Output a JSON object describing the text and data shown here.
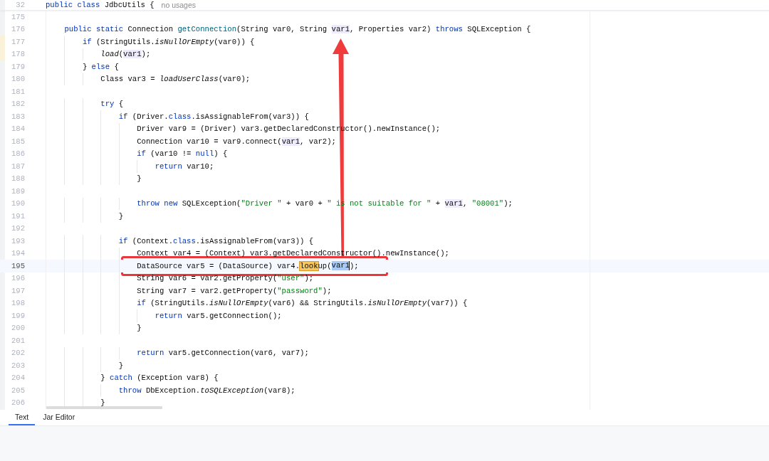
{
  "sticky_header": {
    "line_number": "32",
    "tokens": [
      {
        "text": "public class",
        "kind": "keyword"
      },
      {
        "text": " JdbcUtils {",
        "kind": "plain"
      }
    ],
    "hint": "no usages"
  },
  "code_lines": [
    {
      "number": "175",
      "current": false,
      "changed": false
    },
    {
      "number": "176",
      "current": false,
      "changed": false,
      "tokens": [
        {
          "text": "    public static",
          "kind": "keyword"
        },
        {
          "text": " Connection ",
          "kind": "plain"
        },
        {
          "text": "getConnection",
          "kind": "method"
        },
        {
          "text": "(String var0, String ",
          "kind": "plain"
        },
        {
          "text": "var1",
          "kind": "usage"
        },
        {
          "text": ", Properties var2) ",
          "kind": "plain"
        },
        {
          "text": "throws",
          "kind": "keyword"
        },
        {
          "text": " SQLException {",
          "kind": "plain"
        }
      ]
    },
    {
      "number": "177",
      "current": false,
      "changed": true,
      "tokens": [
        {
          "text": "        if",
          "kind": "keyword"
        },
        {
          "text": " (StringUtils.",
          "kind": "plain"
        },
        {
          "text": "isNullOrEmpty",
          "kind": "static"
        },
        {
          "text": "(var0)) {",
          "kind": "plain"
        }
      ]
    },
    {
      "number": "178",
      "current": false,
      "changed": true,
      "tokens": [
        {
          "text": "            load",
          "kind": "static"
        },
        {
          "text": "(",
          "kind": "plain"
        },
        {
          "text": "var1",
          "kind": "usage"
        },
        {
          "text": ");",
          "kind": "plain"
        }
      ]
    },
    {
      "number": "179",
      "current": false,
      "changed": false,
      "tokens": [
        {
          "text": "        } ",
          "kind": "plain"
        },
        {
          "text": "else",
          "kind": "keyword"
        },
        {
          "text": " {",
          "kind": "plain"
        }
      ]
    },
    {
      "number": "180",
      "current": false,
      "changed": false,
      "tokens": [
        {
          "text": "            Class var3 = ",
          "kind": "plain"
        },
        {
          "text": "loadUserClass",
          "kind": "static"
        },
        {
          "text": "(var0);",
          "kind": "plain"
        }
      ]
    },
    {
      "number": "181",
      "current": false,
      "changed": false
    },
    {
      "number": "182",
      "current": false,
      "changed": false,
      "tokens": [
        {
          "text": "            try",
          "kind": "keyword"
        },
        {
          "text": " {",
          "kind": "plain"
        }
      ]
    },
    {
      "number": "183",
      "current": false,
      "changed": false,
      "tokens": [
        {
          "text": "                if",
          "kind": "keyword"
        },
        {
          "text": " (Driver.",
          "kind": "plain"
        },
        {
          "text": "class",
          "kind": "keyword"
        },
        {
          "text": ".isAssignableFrom(var3)) {",
          "kind": "plain"
        }
      ]
    },
    {
      "number": "184",
      "current": false,
      "changed": false,
      "tokens": [
        {
          "text": "                    Driver var9 = (Driver) var3.getDeclaredConstructor().newInstance();",
          "kind": "plain"
        }
      ]
    },
    {
      "number": "185",
      "current": false,
      "changed": false,
      "tokens": [
        {
          "text": "                    Connection var10 = var9.connect(",
          "kind": "plain"
        },
        {
          "text": "var1",
          "kind": "usage"
        },
        {
          "text": ", var2);",
          "kind": "plain"
        }
      ]
    },
    {
      "number": "186",
      "current": false,
      "changed": false,
      "tokens": [
        {
          "text": "                    if",
          "kind": "keyword"
        },
        {
          "text": " (var10 != ",
          "kind": "plain"
        },
        {
          "text": "null",
          "kind": "keyword"
        },
        {
          "text": ") {",
          "kind": "plain"
        }
      ]
    },
    {
      "number": "187",
      "current": false,
      "changed": false,
      "tokens": [
        {
          "text": "                        return",
          "kind": "keyword"
        },
        {
          "text": " var10;",
          "kind": "plain"
        }
      ]
    },
    {
      "number": "188",
      "current": false,
      "changed": false,
      "tokens": [
        {
          "text": "                    }",
          "kind": "plain"
        }
      ]
    },
    {
      "number": "189",
      "current": false,
      "changed": false
    },
    {
      "number": "190",
      "current": false,
      "changed": false,
      "tokens": [
        {
          "text": "                    throw new",
          "kind": "keyword"
        },
        {
          "text": " SQLException(",
          "kind": "plain"
        },
        {
          "text": "\"Driver \"",
          "kind": "string"
        },
        {
          "text": " + var0 + ",
          "kind": "plain"
        },
        {
          "text": "\" is not suitable for \"",
          "kind": "string"
        },
        {
          "text": " + ",
          "kind": "plain"
        },
        {
          "text": "var1",
          "kind": "usage"
        },
        {
          "text": ", ",
          "kind": "plain"
        },
        {
          "text": "\"08001\"",
          "kind": "string"
        },
        {
          "text": ");",
          "kind": "plain"
        }
      ]
    },
    {
      "number": "191",
      "current": false,
      "changed": false,
      "tokens": [
        {
          "text": "                }",
          "kind": "plain"
        }
      ]
    },
    {
      "number": "192",
      "current": false,
      "changed": false
    },
    {
      "number": "193",
      "current": false,
      "changed": false,
      "tokens": [
        {
          "text": "                if",
          "kind": "keyword"
        },
        {
          "text": " (Context.",
          "kind": "plain"
        },
        {
          "text": "class",
          "kind": "keyword"
        },
        {
          "text": ".isAssignableFrom(var3)) {",
          "kind": "plain"
        }
      ]
    },
    {
      "number": "194",
      "current": false,
      "changed": false,
      "tokens": [
        {
          "text": "                    Context var4 = (Context) var3.getDeclaredConstructor().newInstance();",
          "kind": "plain"
        }
      ]
    },
    {
      "number": "195",
      "current": true,
      "changed": false,
      "tokens": [
        {
          "text": "                    DataSource var5 = (DataSource) var4.",
          "kind": "plain"
        },
        {
          "text": "look",
          "kind": "search-match"
        },
        {
          "text": "up(",
          "kind": "plain"
        },
        {
          "text": "var1",
          "kind": "selection-caret"
        },
        {
          "text": ");",
          "kind": "plain"
        }
      ]
    },
    {
      "number": "196",
      "current": false,
      "changed": false,
      "tokens": [
        {
          "text": "                    String var6 = var2.getProperty(",
          "kind": "plain"
        },
        {
          "text": "\"user\"",
          "kind": "string"
        },
        {
          "text": ");",
          "kind": "plain"
        }
      ]
    },
    {
      "number": "197",
      "current": false,
      "changed": false,
      "tokens": [
        {
          "text": "                    String var7 = var2.getProperty(",
          "kind": "plain"
        },
        {
          "text": "\"password\"",
          "kind": "string"
        },
        {
          "text": ");",
          "kind": "plain"
        }
      ]
    },
    {
      "number": "198",
      "current": false,
      "changed": false,
      "tokens": [
        {
          "text": "                    if",
          "kind": "keyword"
        },
        {
          "text": " (StringUtils.",
          "kind": "plain"
        },
        {
          "text": "isNullOrEmpty",
          "kind": "static"
        },
        {
          "text": "(var6) && StringUtils.",
          "kind": "plain"
        },
        {
          "text": "isNullOrEmpty",
          "kind": "static"
        },
        {
          "text": "(var7)) {",
          "kind": "plain"
        }
      ]
    },
    {
      "number": "199",
      "current": false,
      "changed": false,
      "tokens": [
        {
          "text": "                        return",
          "kind": "keyword"
        },
        {
          "text": " var5.getConnection();",
          "kind": "plain"
        }
      ]
    },
    {
      "number": "200",
      "current": false,
      "changed": false,
      "tokens": [
        {
          "text": "                    }",
          "kind": "plain"
        }
      ]
    },
    {
      "number": "201",
      "current": false,
      "changed": false
    },
    {
      "number": "202",
      "current": false,
      "changed": false,
      "tokens": [
        {
          "text": "                    return",
          "kind": "keyword"
        },
        {
          "text": " var5.getConnection(var6, var7);",
          "kind": "plain"
        }
      ]
    },
    {
      "number": "203",
      "current": false,
      "changed": false,
      "tokens": [
        {
          "text": "                }",
          "kind": "plain"
        }
      ]
    },
    {
      "number": "204",
      "current": false,
      "changed": false,
      "tokens": [
        {
          "text": "            } ",
          "kind": "plain"
        },
        {
          "text": "catch",
          "kind": "keyword"
        },
        {
          "text": " (Exception var8) {",
          "kind": "plain"
        }
      ]
    },
    {
      "number": "205",
      "current": false,
      "changed": false,
      "tokens": [
        {
          "text": "                throw",
          "kind": "keyword"
        },
        {
          "text": " DbException.",
          "kind": "plain"
        },
        {
          "text": "toSQLException",
          "kind": "static"
        },
        {
          "text": "(var8);",
          "kind": "plain"
        }
      ]
    },
    {
      "number": "206",
      "current": false,
      "changed": false,
      "tokens": [
        {
          "text": "            }",
          "kind": "plain"
        }
      ]
    }
  ],
  "tabs": [
    {
      "label": "Text",
      "selected": true
    },
    {
      "label": "Jar Editor",
      "selected": false
    }
  ]
}
